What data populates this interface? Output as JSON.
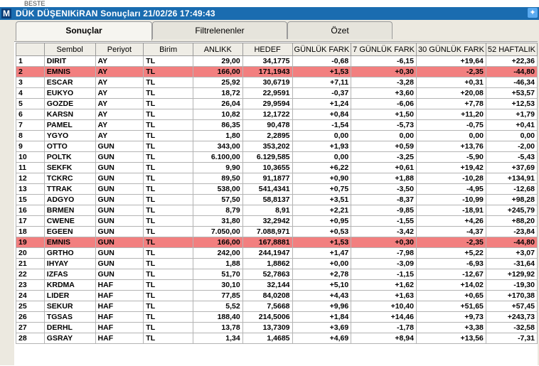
{
  "window": {
    "title": "DÜK DÜŞENIKiRAN Sonuçları  21/02/26 17:49:43",
    "logo": "M",
    "bg_tab": "BESTE"
  },
  "tabs": [
    {
      "label": "Sonuçlar",
      "active": true
    },
    {
      "label": "Filtrelenenler",
      "active": false
    },
    {
      "label": "Özet",
      "active": false
    }
  ],
  "columns": [
    "",
    "Sembol",
    "Periyot",
    "Birim",
    "ANLIKK",
    "HEDEF",
    "GÜNLÜK FARK",
    "7 GÜNLÜK FARK",
    "30 GÜNLÜK FARK",
    "52 HAFTALIK"
  ],
  "rows": [
    [
      "1",
      "DIRIT",
      "AY",
      "TL",
      "29,00",
      "34,1775",
      "-0,68",
      "-6,15",
      "+19,64",
      "+22,36"
    ],
    [
      "2",
      "EMNIS",
      "AY",
      "TL",
      "166,00",
      "171,1943",
      "+1,53",
      "+0,30",
      "-2,35",
      "-44,80"
    ],
    [
      "3",
      "ESCAR",
      "AY",
      "TL",
      "25,92",
      "30,6719",
      "+7,11",
      "-3,28",
      "+0,31",
      "-46,34"
    ],
    [
      "4",
      "EUKYO",
      "AY",
      "TL",
      "18,72",
      "22,9591",
      "-0,37",
      "+3,60",
      "+20,08",
      "+53,57"
    ],
    [
      "5",
      "GOZDE",
      "AY",
      "TL",
      "26,04",
      "29,9594",
      "+1,24",
      "-6,06",
      "+7,78",
      "+12,53"
    ],
    [
      "6",
      "KARSN",
      "AY",
      "TL",
      "10,82",
      "12,1722",
      "+0,84",
      "+1,50",
      "+11,20",
      "+1,79"
    ],
    [
      "7",
      "PAMEL",
      "AY",
      "TL",
      "86,35",
      "90,478",
      "-1,54",
      "-5,73",
      "-0,75",
      "+0,41"
    ],
    [
      "8",
      "YGYO",
      "AY",
      "TL",
      "1,80",
      "2,2895",
      "0,00",
      "0,00",
      "0,00",
      "0,00"
    ],
    [
      "9",
      "OTTO",
      "GUN",
      "TL",
      "343,00",
      "353,202",
      "+1,93",
      "+0,59",
      "+13,76",
      "-2,00"
    ],
    [
      "10",
      "POLTK",
      "GUN",
      "TL",
      "6.100,00",
      "6.129,585",
      "0,00",
      "-3,25",
      "-5,90",
      "-5,43"
    ],
    [
      "11",
      "SEKFK",
      "GUN",
      "TL",
      "9,90",
      "10,3655",
      "+6,22",
      "+0,61",
      "+19,42",
      "+37,69"
    ],
    [
      "12",
      "TCKRC",
      "GUN",
      "TL",
      "89,50",
      "91,1877",
      "+0,90",
      "+1,88",
      "-10,28",
      "+134,91"
    ],
    [
      "13",
      "TTRAK",
      "GUN",
      "TL",
      "538,00",
      "541,4341",
      "+0,75",
      "-3,50",
      "-4,95",
      "-12,68"
    ],
    [
      "15",
      "ADGYO",
      "GUN",
      "TL",
      "57,50",
      "58,8137",
      "+3,51",
      "-8,37",
      "-10,99",
      "+98,28"
    ],
    [
      "16",
      "BRMEN",
      "GUN",
      "TL",
      "8,79",
      "8,91",
      "+2,21",
      "-9,85",
      "-18,91",
      "+245,79"
    ],
    [
      "17",
      "CWENE",
      "GUN",
      "TL",
      "31,80",
      "32,2942",
      "+0,95",
      "-1,55",
      "+4,26",
      "+88,20"
    ],
    [
      "18",
      "EGEEN",
      "GUN",
      "TL",
      "7.050,00",
      "7.088,971",
      "+0,53",
      "-3,42",
      "-4,37",
      "-23,84"
    ],
    [
      "19",
      "EMNIS",
      "GUN",
      "TL",
      "166,00",
      "167,8881",
      "+1,53",
      "+0,30",
      "-2,35",
      "-44,80"
    ],
    [
      "20",
      "GRTHO",
      "GUN",
      "TL",
      "242,00",
      "244,1947",
      "+1,47",
      "-7,98",
      "+5,22",
      "+3,07"
    ],
    [
      "21",
      "IHYAY",
      "GUN",
      "TL",
      "1,88",
      "1,8862",
      "+0,00",
      "-3,09",
      "-6,93",
      "-31,64"
    ],
    [
      "22",
      "IZFAS",
      "GUN",
      "TL",
      "51,70",
      "52,7863",
      "+2,78",
      "-1,15",
      "-12,67",
      "+129,92"
    ],
    [
      "23",
      "KRDMA",
      "HAF",
      "TL",
      "30,10",
      "32,144",
      "+5,10",
      "+1,62",
      "+14,02",
      "-19,30"
    ],
    [
      "24",
      "LIDER",
      "HAF",
      "TL",
      "77,85",
      "84,0208",
      "+4,43",
      "+1,63",
      "+0,65",
      "+170,38"
    ],
    [
      "25",
      "SEKUR",
      "HAF",
      "TL",
      "5,52",
      "7,5668",
      "+9,96",
      "+10,40",
      "+51,65",
      "+57,45"
    ],
    [
      "26",
      "TGSAS",
      "HAF",
      "TL",
      "188,40",
      "214,5006",
      "+1,84",
      "+14,46",
      "+9,73",
      "+243,73"
    ],
    [
      "27",
      "DERHL",
      "HAF",
      "TL",
      "13,78",
      "13,7309",
      "+3,69",
      "-1,78",
      "+3,38",
      "-32,58"
    ],
    [
      "28",
      "GSRAY",
      "HAF",
      "TL",
      "1,34",
      "1,4685",
      "+4,69",
      "+8,94",
      "+13,56",
      "-7,31"
    ]
  ],
  "highlight_rows": [
    1,
    17
  ],
  "colors": {
    "titlebar": "#1a6cb0",
    "highlight": "#f27f7f",
    "panel": "#ece9e0"
  }
}
